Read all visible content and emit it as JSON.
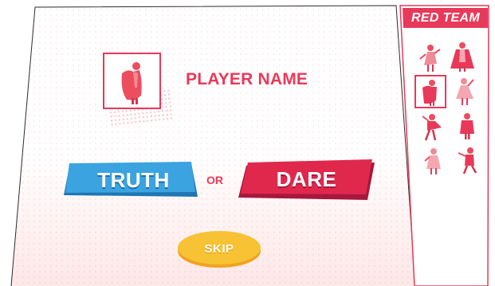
{
  "colors": {
    "brand_red": "#e8395a",
    "truth_blue": "#3aa3e0",
    "dare_red": "#e0284d",
    "skip_yellow": "#f7c233",
    "panel_bg": "#ffffff"
  },
  "player": {
    "name": "PLAYER NAME",
    "avatar_icon": "caped-hero-icon"
  },
  "choices": {
    "truth_label": "TRUTH",
    "or_label": "OR",
    "dare_label": "DARE"
  },
  "skip": {
    "label": "SKIP"
  },
  "team": {
    "title": "RED TEAM",
    "members": [
      {
        "icon": "hero-dancer-icon",
        "selected": false
      },
      {
        "icon": "hero-caped-woman-icon",
        "selected": false
      },
      {
        "icon": "hero-caped-man-icon",
        "selected": true
      },
      {
        "icon": "hero-ballerina-icon",
        "selected": false
      },
      {
        "icon": "hero-flying-icon",
        "selected": false
      },
      {
        "icon": "hero-standing-icon",
        "selected": false
      },
      {
        "icon": "hero-girl-icon",
        "selected": false
      },
      {
        "icon": "hero-runner-icon",
        "selected": false
      }
    ]
  }
}
